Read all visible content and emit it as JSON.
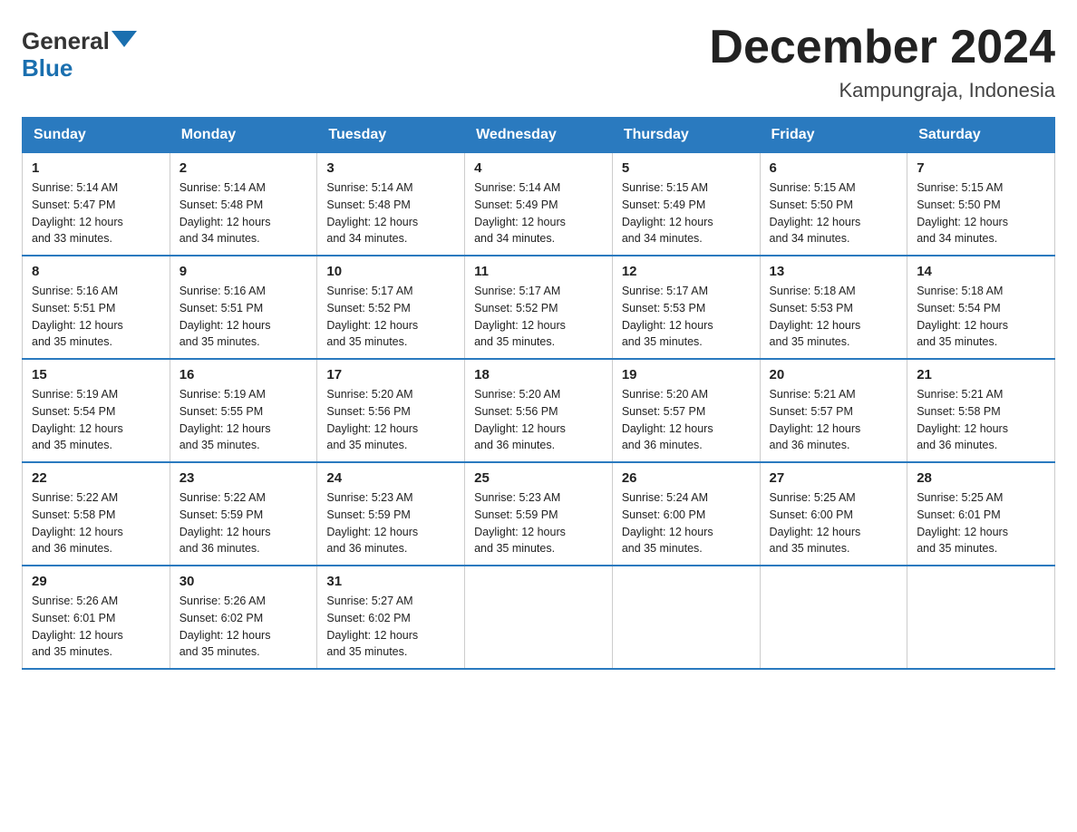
{
  "logo": {
    "general": "General",
    "arrow": "▶",
    "blue": "Blue"
  },
  "title": "December 2024",
  "location": "Kampungraja, Indonesia",
  "days_of_week": [
    "Sunday",
    "Monday",
    "Tuesday",
    "Wednesday",
    "Thursday",
    "Friday",
    "Saturday"
  ],
  "weeks": [
    [
      {
        "day": "1",
        "sunrise": "5:14 AM",
        "sunset": "5:47 PM",
        "daylight": "12 hours and 33 minutes."
      },
      {
        "day": "2",
        "sunrise": "5:14 AM",
        "sunset": "5:48 PM",
        "daylight": "12 hours and 34 minutes."
      },
      {
        "day": "3",
        "sunrise": "5:14 AM",
        "sunset": "5:48 PM",
        "daylight": "12 hours and 34 minutes."
      },
      {
        "day": "4",
        "sunrise": "5:14 AM",
        "sunset": "5:49 PM",
        "daylight": "12 hours and 34 minutes."
      },
      {
        "day": "5",
        "sunrise": "5:15 AM",
        "sunset": "5:49 PM",
        "daylight": "12 hours and 34 minutes."
      },
      {
        "day": "6",
        "sunrise": "5:15 AM",
        "sunset": "5:50 PM",
        "daylight": "12 hours and 34 minutes."
      },
      {
        "day": "7",
        "sunrise": "5:15 AM",
        "sunset": "5:50 PM",
        "daylight": "12 hours and 34 minutes."
      }
    ],
    [
      {
        "day": "8",
        "sunrise": "5:16 AM",
        "sunset": "5:51 PM",
        "daylight": "12 hours and 35 minutes."
      },
      {
        "day": "9",
        "sunrise": "5:16 AM",
        "sunset": "5:51 PM",
        "daylight": "12 hours and 35 minutes."
      },
      {
        "day": "10",
        "sunrise": "5:17 AM",
        "sunset": "5:52 PM",
        "daylight": "12 hours and 35 minutes."
      },
      {
        "day": "11",
        "sunrise": "5:17 AM",
        "sunset": "5:52 PM",
        "daylight": "12 hours and 35 minutes."
      },
      {
        "day": "12",
        "sunrise": "5:17 AM",
        "sunset": "5:53 PM",
        "daylight": "12 hours and 35 minutes."
      },
      {
        "day": "13",
        "sunrise": "5:18 AM",
        "sunset": "5:53 PM",
        "daylight": "12 hours and 35 minutes."
      },
      {
        "day": "14",
        "sunrise": "5:18 AM",
        "sunset": "5:54 PM",
        "daylight": "12 hours and 35 minutes."
      }
    ],
    [
      {
        "day": "15",
        "sunrise": "5:19 AM",
        "sunset": "5:54 PM",
        "daylight": "12 hours and 35 minutes."
      },
      {
        "day": "16",
        "sunrise": "5:19 AM",
        "sunset": "5:55 PM",
        "daylight": "12 hours and 35 minutes."
      },
      {
        "day": "17",
        "sunrise": "5:20 AM",
        "sunset": "5:56 PM",
        "daylight": "12 hours and 35 minutes."
      },
      {
        "day": "18",
        "sunrise": "5:20 AM",
        "sunset": "5:56 PM",
        "daylight": "12 hours and 36 minutes."
      },
      {
        "day": "19",
        "sunrise": "5:20 AM",
        "sunset": "5:57 PM",
        "daylight": "12 hours and 36 minutes."
      },
      {
        "day": "20",
        "sunrise": "5:21 AM",
        "sunset": "5:57 PM",
        "daylight": "12 hours and 36 minutes."
      },
      {
        "day": "21",
        "sunrise": "5:21 AM",
        "sunset": "5:58 PM",
        "daylight": "12 hours and 36 minutes."
      }
    ],
    [
      {
        "day": "22",
        "sunrise": "5:22 AM",
        "sunset": "5:58 PM",
        "daylight": "12 hours and 36 minutes."
      },
      {
        "day": "23",
        "sunrise": "5:22 AM",
        "sunset": "5:59 PM",
        "daylight": "12 hours and 36 minutes."
      },
      {
        "day": "24",
        "sunrise": "5:23 AM",
        "sunset": "5:59 PM",
        "daylight": "12 hours and 36 minutes."
      },
      {
        "day": "25",
        "sunrise": "5:23 AM",
        "sunset": "5:59 PM",
        "daylight": "12 hours and 35 minutes."
      },
      {
        "day": "26",
        "sunrise": "5:24 AM",
        "sunset": "6:00 PM",
        "daylight": "12 hours and 35 minutes."
      },
      {
        "day": "27",
        "sunrise": "5:25 AM",
        "sunset": "6:00 PM",
        "daylight": "12 hours and 35 minutes."
      },
      {
        "day": "28",
        "sunrise": "5:25 AM",
        "sunset": "6:01 PM",
        "daylight": "12 hours and 35 minutes."
      }
    ],
    [
      {
        "day": "29",
        "sunrise": "5:26 AM",
        "sunset": "6:01 PM",
        "daylight": "12 hours and 35 minutes."
      },
      {
        "day": "30",
        "sunrise": "5:26 AM",
        "sunset": "6:02 PM",
        "daylight": "12 hours and 35 minutes."
      },
      {
        "day": "31",
        "sunrise": "5:27 AM",
        "sunset": "6:02 PM",
        "daylight": "12 hours and 35 minutes."
      },
      null,
      null,
      null,
      null
    ]
  ],
  "labels": {
    "sunrise": "Sunrise:",
    "sunset": "Sunset:",
    "daylight": "Daylight:"
  }
}
